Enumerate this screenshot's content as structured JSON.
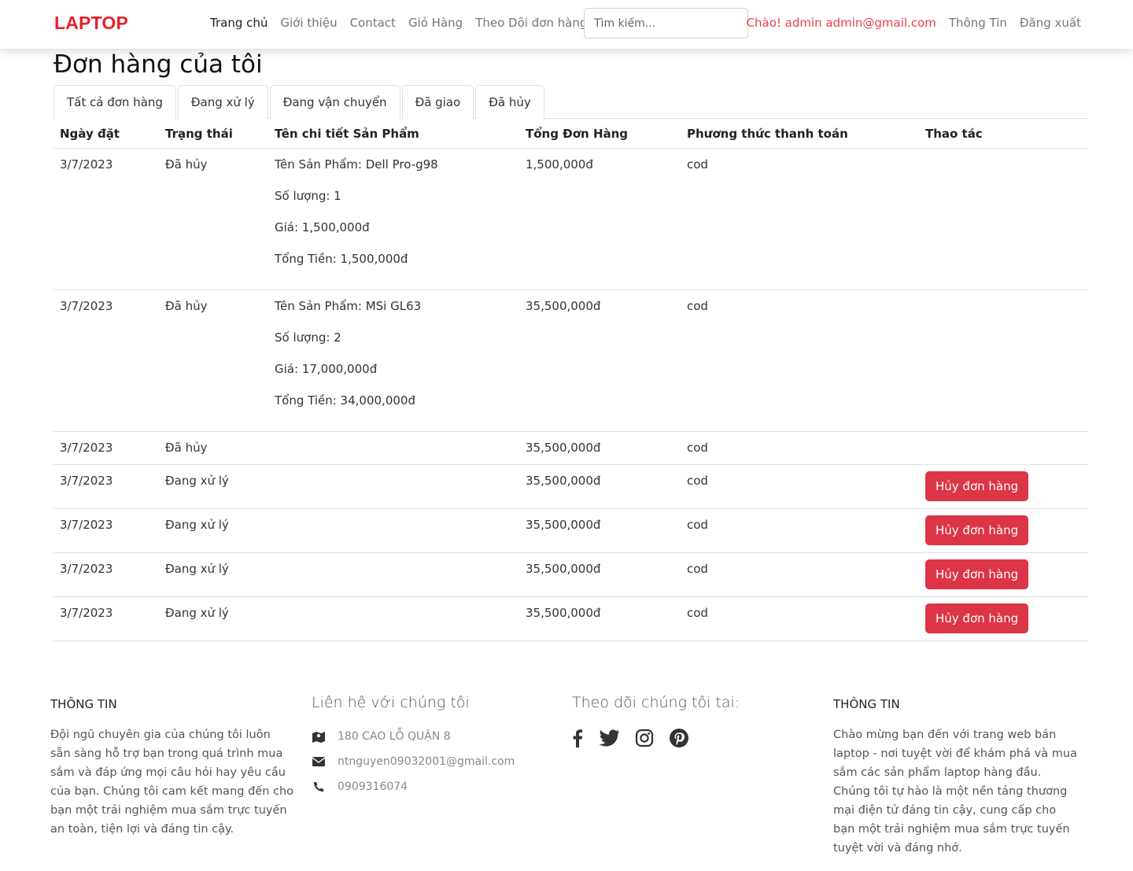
{
  "brand": "LAPTOP",
  "nav": {
    "links": [
      "Trang chủ",
      "Giới thiệu",
      "Contact",
      "Giỏ Hàng",
      "Theo Dõi đơn hàng"
    ],
    "search_placeholder": "Tìm kiếm...",
    "greeting": "Chào! admin admin@gmail.com",
    "profile": "Thông Tin",
    "logout": "Đăng xuất"
  },
  "page_title": "Đơn hàng của tôi",
  "tabs": [
    "Tất cả đơn hàng",
    "Đang xử lý",
    "Đang vận chuyển",
    "Đã giao",
    "Đã hủy"
  ],
  "table": {
    "headers": [
      "Ngày đặt",
      "Trạng thái",
      "Tên chi tiết Sản Phẩm",
      "Tổng Đơn Hàng",
      "Phương thức thanh toán",
      "Thao tác"
    ],
    "cancel_label": "Hủy đơn hàng",
    "rows": [
      {
        "date": "3/7/2023",
        "status": "Đã hủy",
        "product": "Tên Sản Phẩm: Dell Pro-g98",
        "qty": "Số lượng: 1",
        "price": "Giá: 1,500,000đ",
        "subtotal": "Tổng Tiền: 1,500,000đ",
        "total": "1,500,000đ",
        "payment": "cod"
      },
      {
        "date": "3/7/2023",
        "status": "Đã hủy",
        "product": "Tên Sản Phẩm: MSi GL63",
        "qty": "Số lượng: 2",
        "price": "Giá: 17,000,000đ",
        "subtotal": "Tổng Tiền: 34,000,000đ",
        "total": "35,500,000đ",
        "payment": "cod"
      },
      {
        "date": "3/7/2023",
        "status": "Đã hủy",
        "total": "35,500,000đ",
        "payment": "cod"
      },
      {
        "date": "3/7/2023",
        "status": "Đang xử lý",
        "total": "35,500,000đ",
        "payment": "cod"
      },
      {
        "date": "3/7/2023",
        "status": "Đang xử lý",
        "total": "35,500,000đ",
        "payment": "cod"
      },
      {
        "date": "3/7/2023",
        "status": "Đang xử lý",
        "total": "35,500,000đ",
        "payment": "cod"
      },
      {
        "date": "3/7/2023",
        "status": "Đang xử lý",
        "total": "35,500,000đ",
        "payment": "cod"
      }
    ]
  },
  "footer": {
    "col1": {
      "title": "THÔNG TIN",
      "text": "Đội ngũ chuyên gia của chúng tôi luôn sẵn sàng hỗ trợ bạn trong quá trình mua sắm và đáp ứng mọi câu hỏi hay yêu cầu của bạn. Chúng tôi cam kết mang đến cho bạn một trải nghiệm mua sắm trực tuyến an toàn, tiện lợi và đáng tin cậy."
    },
    "col2": {
      "title": "Liên hệ với chúng tôi",
      "address": "180 CAO LỖ QUẬN 8",
      "email": "ntnguyen09032001@gmail.com",
      "phone": "0909316074",
      "address_icon": "map-icon",
      "email_icon": "envelope-icon",
      "phone_icon": "phone-icon"
    },
    "col3": {
      "title": "Theo dõi chúng tôi tại:",
      "icons": [
        "facebook-icon",
        "twitter-icon",
        "instagram-icon",
        "pinterest-icon"
      ]
    },
    "col4": {
      "title": "THÔNG TIN",
      "text": "Chào mừng bạn đến với trang web bán laptop - nơi tuyệt vời để khám phá và mua sắm các sản phẩm laptop hàng đầu. Chúng tôi tự hào là một nền tảng thương mại điện tử đáng tin cậy, cung cấp cho bạn một trải nghiệm mua sắm trực tuyến tuyệt vời và đáng nhớ."
    }
  },
  "colors": {
    "brand": "#e8202a",
    "greeting": "#e8434d",
    "danger_button": "#dc3545"
  }
}
